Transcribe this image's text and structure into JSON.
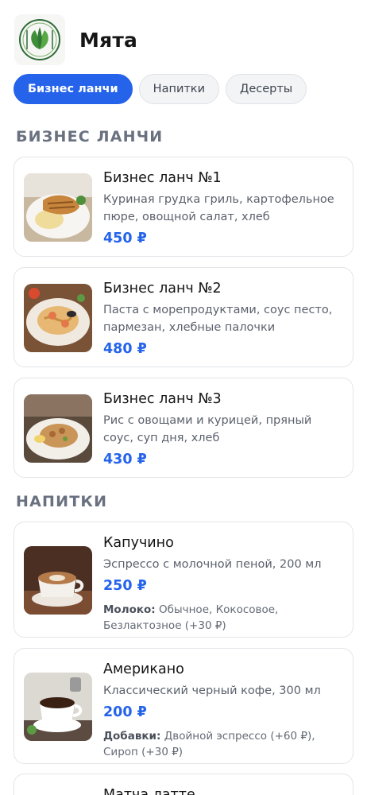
{
  "brand": {
    "name": "Мята",
    "logo_icon": "mint-leaves-icon"
  },
  "tabs": [
    {
      "label": "Бизнес ланчи",
      "active": true
    },
    {
      "label": "Напитки",
      "active": false
    },
    {
      "label": "Десерты",
      "active": false
    }
  ],
  "sections": {
    "lunch": {
      "title": "БИЗНЕС ЛАНЧИ",
      "items": [
        {
          "name": "Бизнес ланч №1",
          "desc": "Куриная грудка гриль, картофельное пюре, овощной салат, хлеб",
          "price": "450 ₽",
          "image_icon": "grilled-chicken-plate-icon"
        },
        {
          "name": "Бизнес ланч №2",
          "desc": "Паста с морепродуктами, соус песто, пармезан, хлебные палочки",
          "price": "480 ₽",
          "image_icon": "seafood-pasta-plate-icon"
        },
        {
          "name": "Бизнес ланч №3",
          "desc": "Рис с овощами и курицей, пряный соус, суп дня, хлеб",
          "price": "430 ₽",
          "image_icon": "rice-chicken-plate-icon"
        }
      ]
    },
    "drinks": {
      "title": "НАПИТКИ",
      "items": [
        {
          "name": "Капучино",
          "desc": "Эспрессо с молочной пеной, 200 мл",
          "price": "250 ₽",
          "options_label": "Молоко:",
          "options_text": "Обычное, Кокосовое, Безлактозное (+30 ₽)",
          "image_icon": "cappuccino-cup-icon"
        },
        {
          "name": "Американо",
          "desc": "Классический черный кофе, 300 мл",
          "price": "200 ₽",
          "options_label": "Добавки:",
          "options_text": "Двойной эспрессо (+60 ₽), Сироп (+30 ₽)",
          "image_icon": "americano-cup-icon"
        },
        {
          "name": "Матча латте"
        }
      ]
    }
  },
  "colors": {
    "accent": "#2563eb",
    "section_title": "#697180",
    "card_border": "#e3e5e9"
  }
}
